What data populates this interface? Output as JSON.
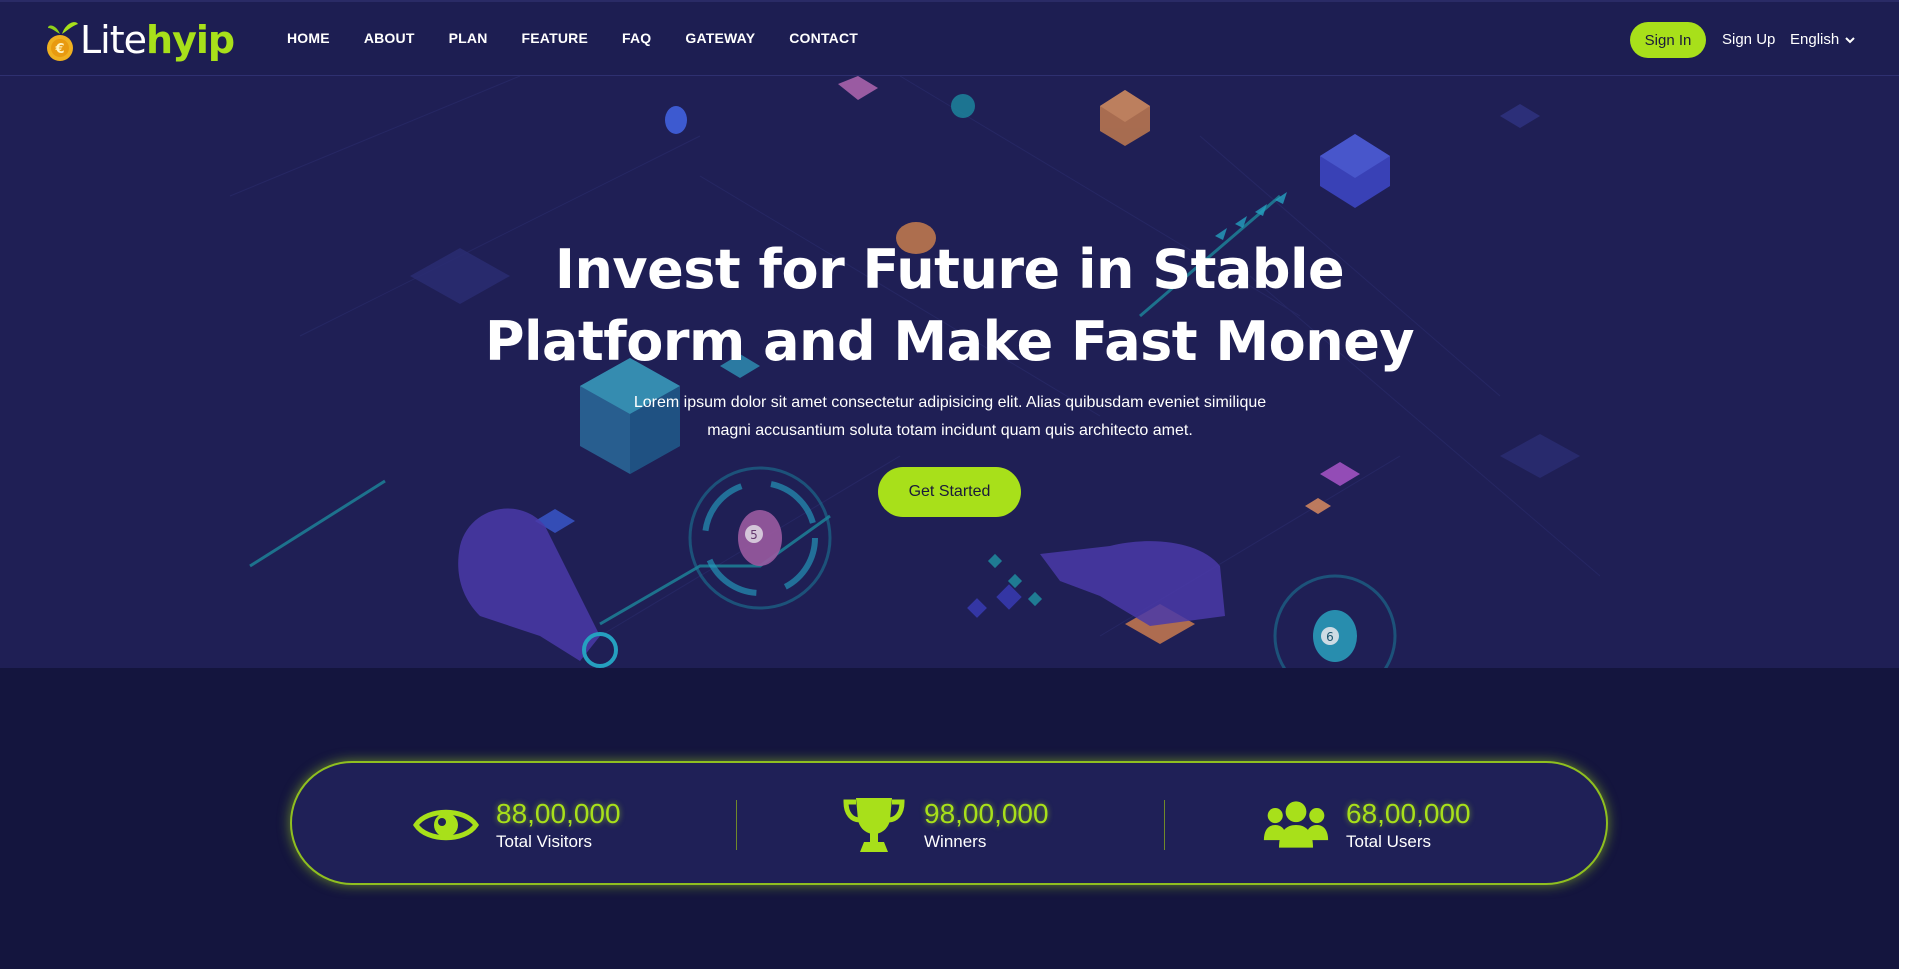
{
  "brand": {
    "logo_lite": "Lite",
    "logo_hyip": "hyip",
    "accent": "#a8e01a",
    "bg": "#14153e"
  },
  "nav": {
    "items": [
      "HOME",
      "ABOUT",
      "PLAN",
      "FEATURE",
      "FAQ",
      "GATEWAY",
      "CONTACT"
    ]
  },
  "header": {
    "signin_label": "Sign In",
    "signup_label": "Sign Up",
    "language": "English"
  },
  "hero": {
    "title_line1": "Invest for Future in Stable",
    "title_line2": "Platform and Make Fast Money",
    "subtitle_line1": "Lorem ipsum dolor sit amet consectetur adipisicing elit. Alias quibusdam eveniet similique",
    "subtitle_line2": "magni accusantium soluta totam incidunt quam quis architecto amet.",
    "cta_label": "Get Started"
  },
  "stats": [
    {
      "icon": "eye-icon",
      "value": "88,00,000",
      "label": "Total Visitors"
    },
    {
      "icon": "trophy-icon",
      "value": "98,00,000",
      "label": "Winners"
    },
    {
      "icon": "users-icon",
      "value": "68,00,000",
      "label": "Total Users"
    }
  ]
}
